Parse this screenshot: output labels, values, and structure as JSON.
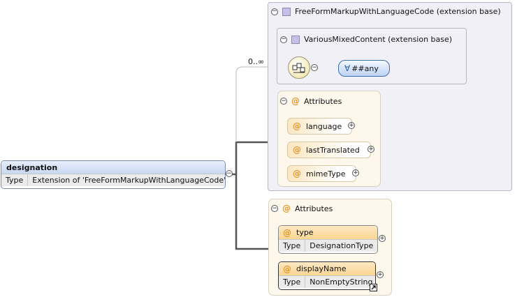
{
  "root": {
    "name": "designation",
    "type_key": "Type",
    "type_value": "Extension of 'FreeFormMarkupWithLanguageCode'"
  },
  "occurrence": "0..∞",
  "ext1": {
    "title": "FreeFormMarkupWithLanguageCode (extension base)"
  },
  "ext2": {
    "title": "VariousMixedContent (extension base)"
  },
  "any_label": "##any",
  "any_symbol": "∀",
  "attrs1": {
    "title": "Attributes",
    "items": [
      {
        "name": "language"
      },
      {
        "name": "lastTranslated"
      },
      {
        "name": "mimeType"
      }
    ]
  },
  "attrs2": {
    "title": "Attributes",
    "items": [
      {
        "name": "type",
        "type_key": "Type",
        "type_value": "DesignationType"
      },
      {
        "name": "displayName",
        "type_key": "Type",
        "type_value": "NonEmptyString"
      }
    ]
  },
  "symbols": {
    "attr": "@",
    "expand": "+",
    "collapse": "−"
  }
}
